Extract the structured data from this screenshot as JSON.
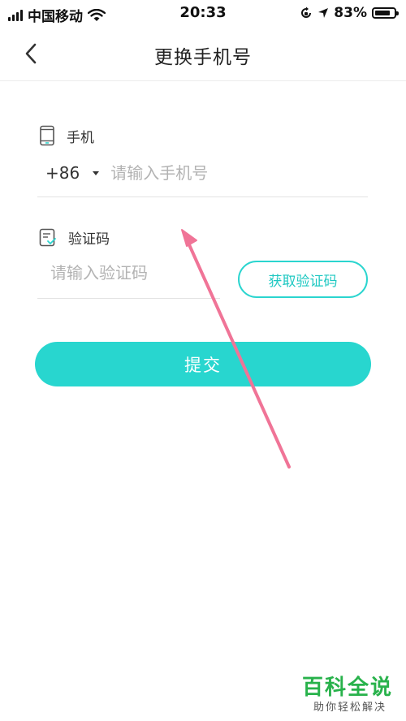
{
  "status_bar": {
    "carrier": "中国移动",
    "time": "20:33",
    "battery_percent": "83%",
    "battery_level": 0.83,
    "icons": [
      "signal-icon",
      "wifi-icon",
      "orientation-lock-icon",
      "location-icon",
      "battery-icon"
    ]
  },
  "nav": {
    "title": "更换手机号",
    "back_icon": "chevron-left-icon"
  },
  "phone_field": {
    "label": "手机",
    "icon": "phone-icon",
    "country_code": "+86",
    "placeholder": "请输入手机号"
  },
  "code_field": {
    "label": "验证码",
    "icon": "verify-icon",
    "placeholder": "请输入验证码",
    "get_code_label": "获取验证码"
  },
  "submit": {
    "label": "提交"
  },
  "watermark": {
    "title": "百科全说",
    "subtitle": "助你轻松解决"
  },
  "colors": {
    "accent": "#28d6cf",
    "annotation": "#f07497",
    "watermark": "#28b24b"
  }
}
